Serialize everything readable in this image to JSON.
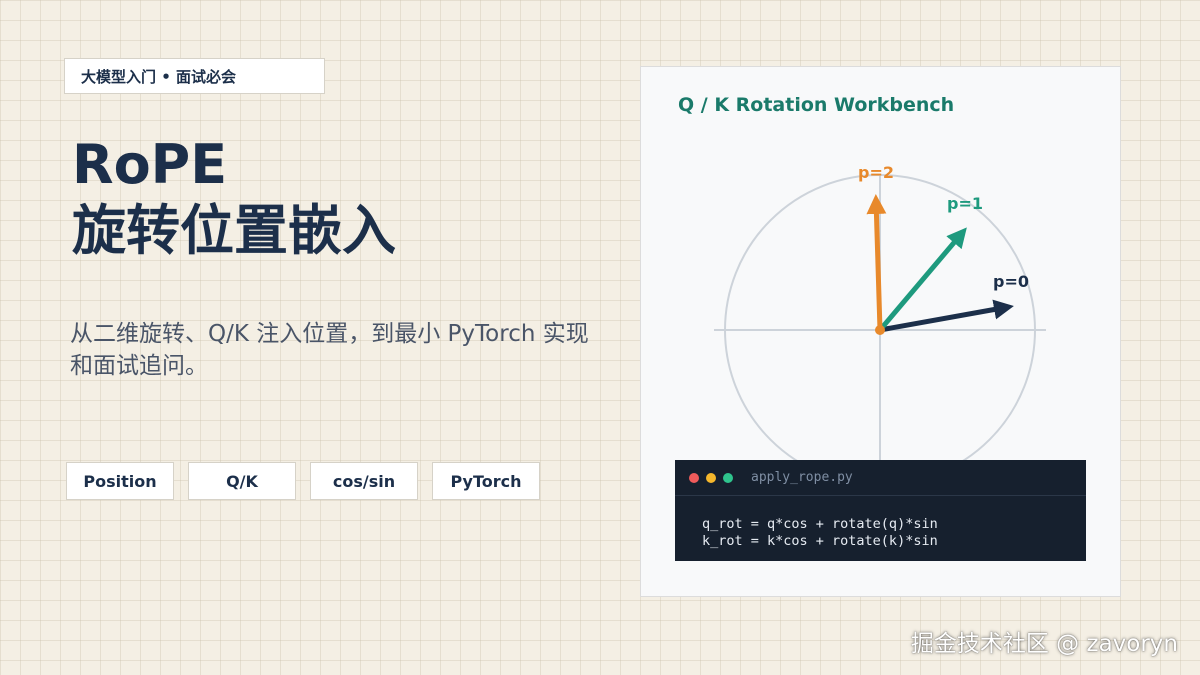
{
  "header": {
    "tag": "大模型入门 • 面试必会",
    "title_line1": "RoPE",
    "title_line2": "旋转位置嵌入",
    "subtitle": "从二维旋转、Q/K 注入位置，到最小 PyTorch 实现和面试追问。"
  },
  "chips": [
    "Position",
    "Q/K",
    "cos/sin",
    "PyTorch"
  ],
  "panel": {
    "title": "Q / K Rotation Workbench",
    "vectors": [
      {
        "label": "p=0",
        "color": "#1c2f4a"
      },
      {
        "label": "p=1",
        "color": "#1e9a7e"
      },
      {
        "label": "p=2",
        "color": "#e8892b"
      }
    ],
    "code": {
      "filename": "apply_rope.py",
      "dots": [
        "#ff5f57",
        "#febc2e",
        "#28c840"
      ],
      "lines": [
        "q_rot = q*cos + rotate(q)*sin",
        "k_rot = k*cos + rotate(k)*sin"
      ]
    }
  },
  "watermark": "掘金技术社区 @ zavoryn"
}
